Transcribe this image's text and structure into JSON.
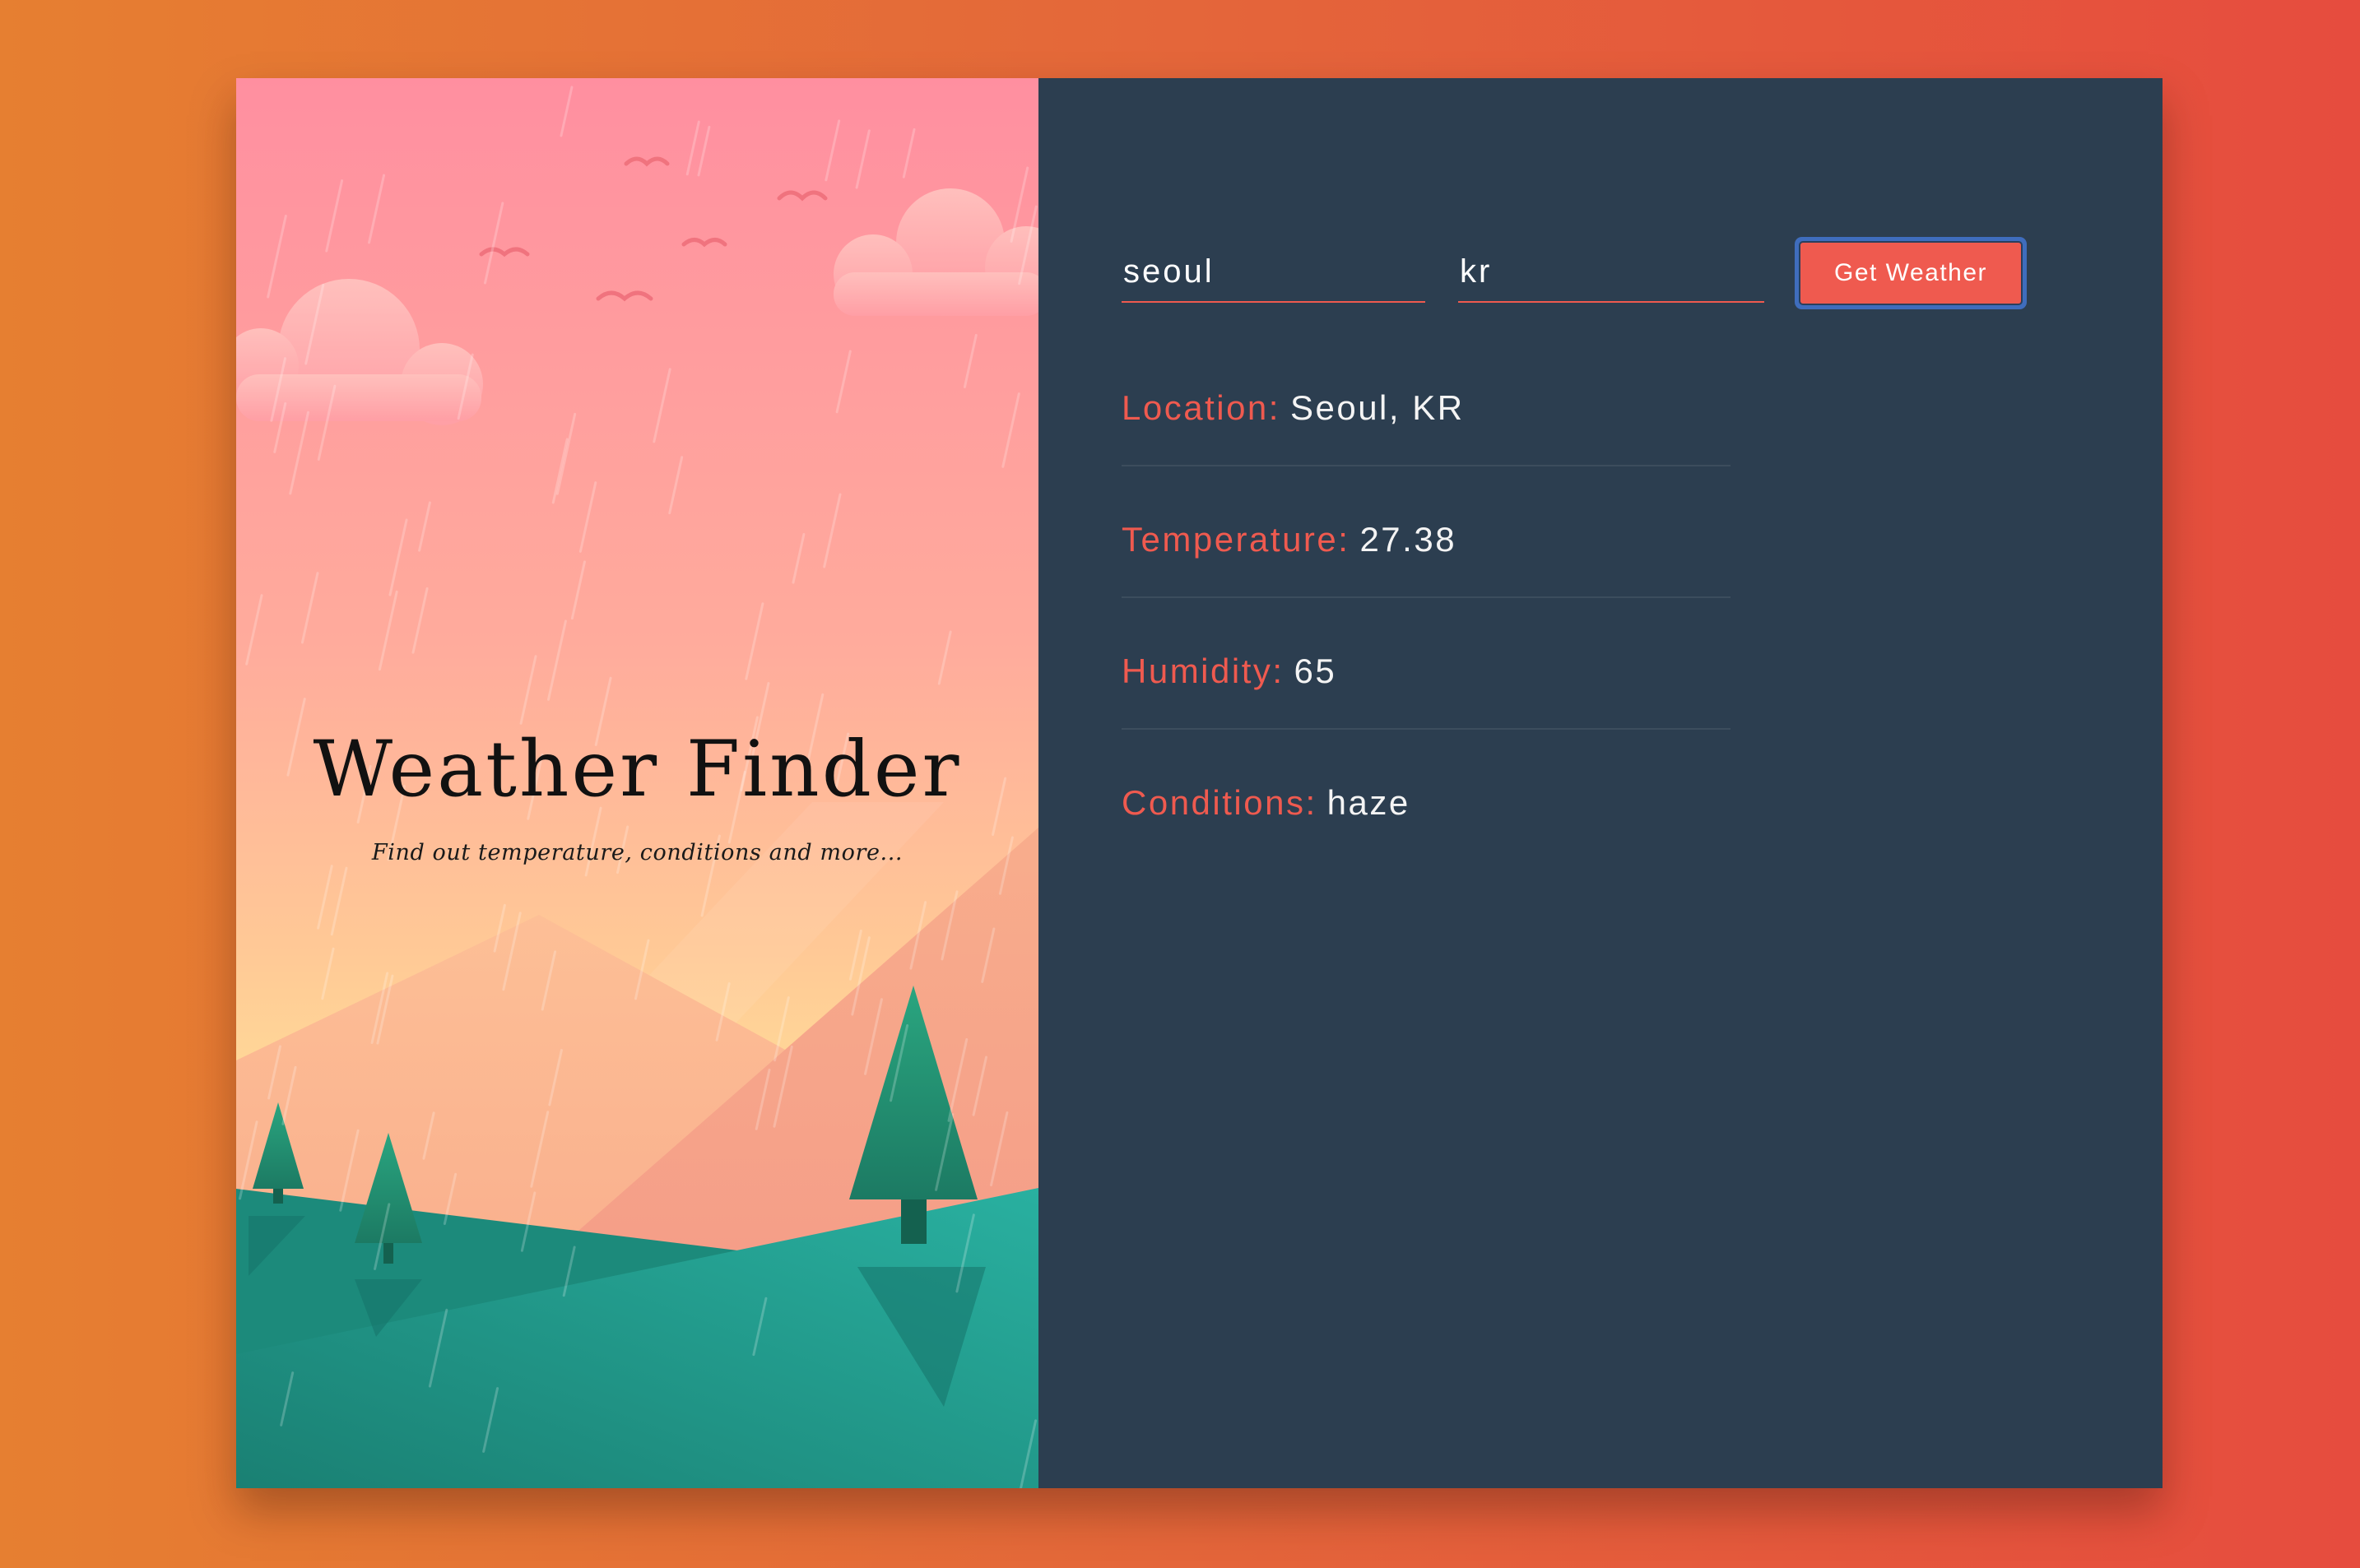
{
  "app": {
    "title": "Weather Finder",
    "subtitle": "Find out temperature, conditions and more..."
  },
  "form": {
    "city_value": "seoul",
    "country_value": "kr",
    "submit_label": "Get Weather"
  },
  "results": [
    {
      "label": "Location:",
      "value": "Seoul, KR"
    },
    {
      "label": "Temperature:",
      "value": "27.38"
    },
    {
      "label": "Humidity:",
      "value": "65"
    },
    {
      "label": "Conditions:",
      "value": "haze"
    }
  ],
  "colors": {
    "accent": "#ef5a4f",
    "panel": "#2c3e50",
    "focus_ring": "#3f6dbd"
  }
}
